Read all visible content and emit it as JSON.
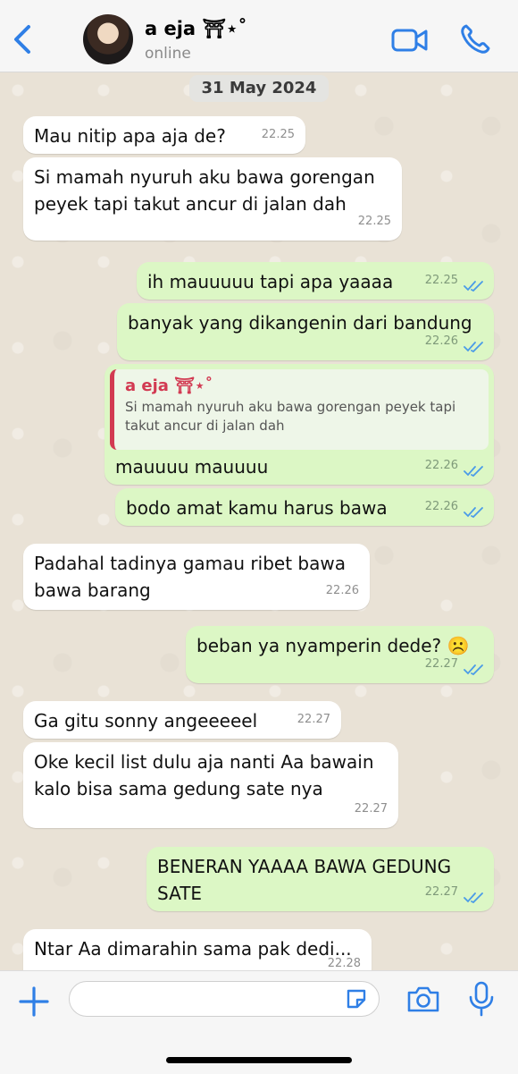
{
  "header": {
    "contact_name": "a eja ⛩⋆˚",
    "status": "online"
  },
  "date_chip": "31 May 2024",
  "messages": [
    {
      "text": "Mau nitip apa aja de?",
      "time": "22.25"
    },
    {
      "text": "Si mamah nyuruh aku bawa gorengan peyek tapi takut ancur di jalan dah",
      "time": "22.25"
    },
    {
      "text": "ih mauuuuu tapi apa yaaaa",
      "time": "22.25"
    },
    {
      "text": "banyak yang dikangenin dari bandung",
      "time": "22.26"
    },
    {
      "text": "mauuuu mauuuu",
      "time": "22.26",
      "quote_name": "a eja ⛩⋆˚",
      "quote_text": "Si mamah nyuruh aku bawa gorengan peyek tapi takut ancur di jalan dah"
    },
    {
      "text": "bodo amat kamu harus bawa",
      "time": "22.26"
    },
    {
      "text": "Padahal tadinya gamau ribet bawa bawa barang",
      "time": "22.26"
    },
    {
      "text": "beban ya nyamperin dede? ☹️",
      "time": "22.27"
    },
    {
      "text": "Ga gitu sonny angeeeeel",
      "time": "22.27"
    },
    {
      "text": "Oke kecil list dulu aja nanti Aa bawain kalo bisa sama gedung sate nya",
      "time": "22.27"
    },
    {
      "text": "BENERAN YAAAA BAWA GEDUNG SATE",
      "time": "22.27"
    },
    {
      "text": "Ntar Aa dimarahin sama pak dedi...",
      "time": "22.28"
    }
  ],
  "colors": {
    "accent": "#2f7fe6",
    "incoming": "#ffffff",
    "outgoing": "#dcf7c5",
    "quote_name": "#d23a52",
    "read_ticks": "#4a9be8"
  },
  "icons": [
    "back-chevron-icon",
    "video-call-icon",
    "phone-icon",
    "plus-icon",
    "sticker-icon",
    "camera-icon",
    "microphone-icon",
    "double-check-icon"
  ]
}
